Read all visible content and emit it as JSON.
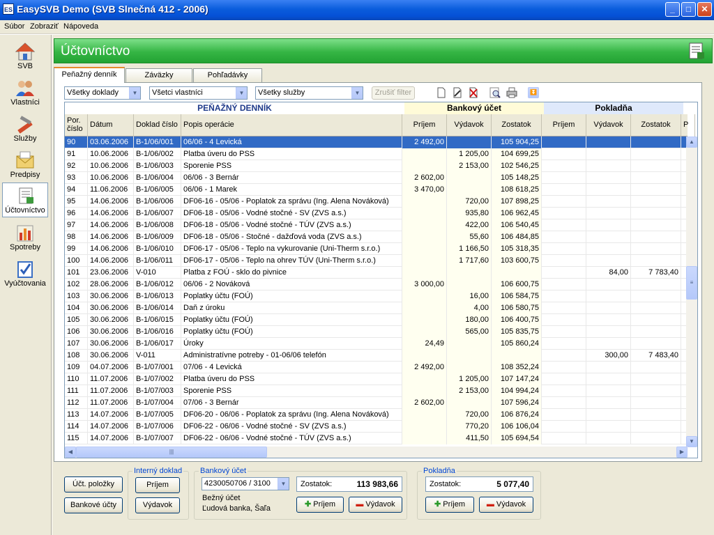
{
  "window": {
    "title": "EasySVB Demo  (SVB Slnečná 412 - 2006)",
    "icon_text": "ES",
    "minimize": "_",
    "maximize": "□",
    "close": "✕"
  },
  "menu": [
    "Súbor",
    "Zobraziť",
    "Nápoveda"
  ],
  "sidebar": [
    {
      "label": "SVB"
    },
    {
      "label": "Vlastníci"
    },
    {
      "label": "Služby"
    },
    {
      "label": "Predpisy"
    },
    {
      "label": "Účtovníctvo"
    },
    {
      "label": "Spotreby"
    },
    {
      "label": "Vyúčtovania"
    }
  ],
  "header": {
    "title": "Účtovníctvo"
  },
  "tabs": [
    "Peňažný denník",
    "Záväzky",
    "Pohľadávky"
  ],
  "filters": {
    "doklady": "Všetky doklady",
    "vlastnici": "Všetci vlastníci",
    "sluzby": "Všetky služby",
    "zrusit": "Zrušiť filter"
  },
  "grid": {
    "band_title": "PEŇAŽNÝ DENNÍK",
    "band_bank": "Bankový účet",
    "band_cash": "Pokladňa",
    "columns": [
      "Por. číslo",
      "Dátum",
      "Doklad číslo",
      "Popis operácie",
      "Príjem",
      "Výdavok",
      "Zostatok",
      "Príjem",
      "Výdavok",
      "Zostatok",
      "P"
    ],
    "rows": [
      [
        "90",
        "03.06.2006",
        "B-1/06/001",
        "06/06 - 4 Levická",
        "2 492,00",
        "",
        "105 904,25",
        "",
        "",
        ""
      ],
      [
        "91",
        "10.06.2006",
        "B-1/06/002",
        "Platba úveru do PSS",
        "",
        "1 205,00",
        "104 699,25",
        "",
        "",
        ""
      ],
      [
        "92",
        "10.06.2006",
        "B-1/06/003",
        "Sporenie  PSS",
        "",
        "2 153,00",
        "102 546,25",
        "",
        "",
        ""
      ],
      [
        "93",
        "10.06.2006",
        "B-1/06/004",
        "06/06 - 3 Bernár",
        "2 602,00",
        "",
        "105 148,25",
        "",
        "",
        ""
      ],
      [
        "94",
        "11.06.2006",
        "B-1/06/005",
        "06/06 - 1 Marek",
        "3 470,00",
        "",
        "108 618,25",
        "",
        "",
        ""
      ],
      [
        "95",
        "14.06.2006",
        "B-1/06/006",
        "DF06-16 - 05/06 - Poplatok za správu (Ing. Alena Nováková)",
        "",
        "720,00",
        "107 898,25",
        "",
        "",
        ""
      ],
      [
        "96",
        "14.06.2006",
        "B-1/06/007",
        "DF06-18 - 05/06 - Vodné stočné - SV (ZVS a.s.)",
        "",
        "935,80",
        "106 962,45",
        "",
        "",
        ""
      ],
      [
        "97",
        "14.06.2006",
        "B-1/06/008",
        "DF06-18 - 05/06 - Vodné stočné - TÚV (ZVS a.s.)",
        "",
        "422,00",
        "106 540,45",
        "",
        "",
        ""
      ],
      [
        "98",
        "14.06.2006",
        "B-1/06/009",
        "DF06-18 - 05/06 - Stočné - dažďová voda (ZVS a.s.)",
        "",
        "55,60",
        "106 484,85",
        "",
        "",
        ""
      ],
      [
        "99",
        "14.06.2006",
        "B-1/06/010",
        "DF06-17 - 05/06 - Teplo na vykurovanie (Uni-Therm s.r.o.)",
        "",
        "1 166,50",
        "105 318,35",
        "",
        "",
        ""
      ],
      [
        "100",
        "14.06.2006",
        "B-1/06/011",
        "DF06-17 - 05/06 - Teplo na ohrev TÚV (Uni-Therm s.r.o.)",
        "",
        "1 717,60",
        "103 600,75",
        "",
        "",
        ""
      ],
      [
        "101",
        "23.06.2006",
        "V-010",
        "Platba z FOÚ - sklo do pivnice",
        "",
        "",
        "",
        "",
        "84,00",
        "7 783,40"
      ],
      [
        "102",
        "28.06.2006",
        "B-1/06/012",
        "06/06 - 2 Nováková",
        "3 000,00",
        "",
        "106 600,75",
        "",
        "",
        ""
      ],
      [
        "103",
        "30.06.2006",
        "B-1/06/013",
        "Poplatky účtu (FOÚ)",
        "",
        "16,00",
        "106 584,75",
        "",
        "",
        ""
      ],
      [
        "104",
        "30.06.2006",
        "B-1/06/014",
        "Daň z úroku",
        "",
        "4,00",
        "106 580,75",
        "",
        "",
        ""
      ],
      [
        "105",
        "30.06.2006",
        "B-1/06/015",
        "Poplatky účtu (FOÚ)",
        "",
        "180,00",
        "106 400,75",
        "",
        "",
        ""
      ],
      [
        "106",
        "30.06.2006",
        "B-1/06/016",
        "Poplatky účtu (FOÚ)",
        "",
        "565,00",
        "105 835,75",
        "",
        "",
        ""
      ],
      [
        "107",
        "30.06.2006",
        "B-1/06/017",
        "Úroky",
        "24,49",
        "",
        "105 860,24",
        "",
        "",
        ""
      ],
      [
        "108",
        "30.06.2006",
        "V-011",
        "Administratívne potreby - 01-06/06 telefón",
        "",
        "",
        "",
        "",
        "300,00",
        "7 483,40"
      ],
      [
        "109",
        "04.07.2006",
        "B-1/07/001",
        "07/06 - 4 Levická",
        "2 492,00",
        "",
        "108 352,24",
        "",
        "",
        ""
      ],
      [
        "110",
        "11.07.2006",
        "B-1/07/002",
        "Platba úveru do PSS",
        "",
        "1 205,00",
        "107 147,24",
        "",
        "",
        ""
      ],
      [
        "111",
        "11.07.2006",
        "B-1/07/003",
        "Sporenie  PSS",
        "",
        "2 153,00",
        "104 994,24",
        "",
        "",
        ""
      ],
      [
        "112",
        "11.07.2006",
        "B-1/07/004",
        "07/06 - 3 Bernár",
        "2 602,00",
        "",
        "107 596,24",
        "",
        "",
        ""
      ],
      [
        "113",
        "14.07.2006",
        "B-1/07/005",
        "DF06-20 - 06/06 - Poplatok za správu (Ing. Alena Nováková)",
        "",
        "720,00",
        "106 876,24",
        "",
        "",
        ""
      ],
      [
        "114",
        "14.07.2006",
        "B-1/07/006",
        "DF06-22 - 06/06 - Vodné stočné - SV (ZVS a.s.)",
        "",
        "770,20",
        "106 106,04",
        "",
        "",
        ""
      ],
      [
        "115",
        "14.07.2006",
        "B-1/07/007",
        "DF06-22 - 06/06 - Vodné stočné - TÚV (ZVS a.s.)",
        "",
        "411,50",
        "105 694,54",
        "",
        "",
        ""
      ]
    ]
  },
  "bottom": {
    "uct_polozky": "Účt. položky",
    "bankove_ucty": "Bankové účty",
    "interny_label": "Interný doklad",
    "interny_prijem": "Príjem",
    "interny_vydavok": "Výdavok",
    "bank_label": "Bankový účet",
    "bank_account": "4230050706 / 3100",
    "bank_type": "Bežný účet",
    "bank_name": "Ľudová banka, Šaľa",
    "bank_zostatok_label": "Zostatok:",
    "bank_zostatok": "113 983,66",
    "bank_prijem": "Príjem",
    "bank_vydavok": "Výdavok",
    "cash_label": "Pokladňa",
    "cash_zostatok_label": "Zostatok:",
    "cash_zostatok": "5 077,40",
    "cash_prijem": "Príjem",
    "cash_vydavok": "Výdavok"
  }
}
